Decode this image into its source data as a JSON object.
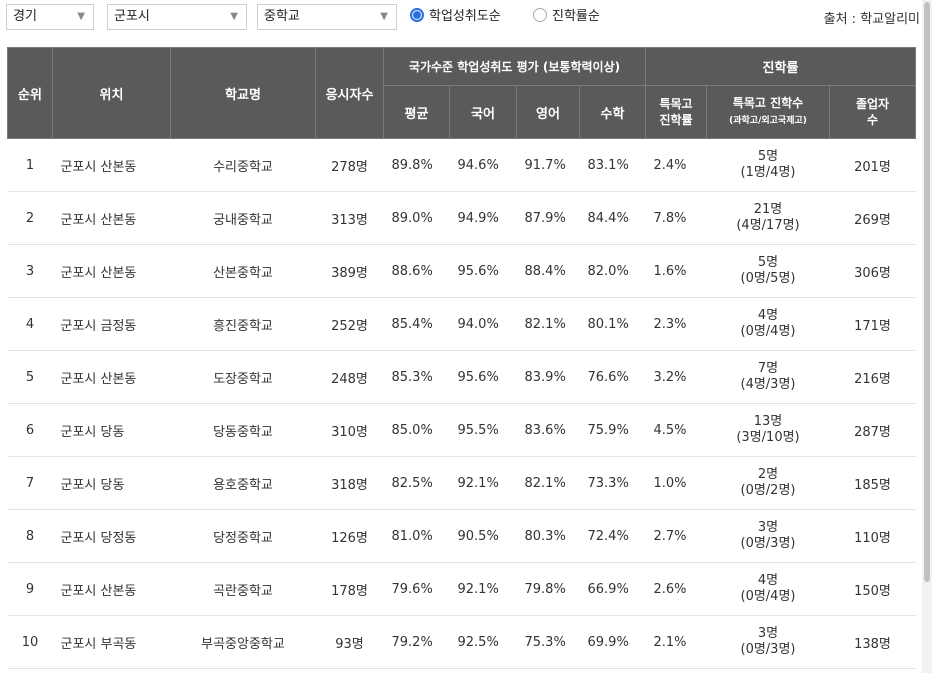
{
  "filters": {
    "province": "경기",
    "city": "군포시",
    "level": "중학교",
    "sort_options": [
      {
        "label": "학업성취도순",
        "selected": true
      },
      {
        "label": "진학률순",
        "selected": false
      }
    ],
    "source": "출처 : 학교알리미"
  },
  "table": {
    "headers": {
      "rank": "순위",
      "location": "위치",
      "school": "학교명",
      "examinees": "응시자수",
      "assessment_group": "국가수준 학업성취도 평가 (보통학력이상)",
      "avg": "평균",
      "korean": "국어",
      "english": "영어",
      "math": "수학",
      "advancement_group": "진학률",
      "special_rate_1": "특목고",
      "special_rate_2": "진학률",
      "special_count_1": "특목고 진학수",
      "special_count_2": "(과학고/외고국제고)",
      "graduates_1": "졸업자",
      "graduates_2": "수"
    },
    "rows": [
      {
        "rank": "1",
        "location": "군포시 산본동",
        "school": "수리중학교",
        "examinees": "278명",
        "avg": "89.8%",
        "korean": "94.6%",
        "english": "91.7%",
        "math": "83.1%",
        "special_rate": "2.4%",
        "special_count": "5명",
        "special_detail": "(1명/4명)",
        "graduates": "201명"
      },
      {
        "rank": "2",
        "location": "군포시 산본동",
        "school": "궁내중학교",
        "examinees": "313명",
        "avg": "89.0%",
        "korean": "94.9%",
        "english": "87.9%",
        "math": "84.4%",
        "special_rate": "7.8%",
        "special_count": "21명",
        "special_detail": "(4명/17명)",
        "graduates": "269명"
      },
      {
        "rank": "3",
        "location": "군포시 산본동",
        "school": "산본중학교",
        "examinees": "389명",
        "avg": "88.6%",
        "korean": "95.6%",
        "english": "88.4%",
        "math": "82.0%",
        "special_rate": "1.6%",
        "special_count": "5명",
        "special_detail": "(0명/5명)",
        "graduates": "306명"
      },
      {
        "rank": "4",
        "location": "군포시 금정동",
        "school": "흥진중학교",
        "examinees": "252명",
        "avg": "85.4%",
        "korean": "94.0%",
        "english": "82.1%",
        "math": "80.1%",
        "special_rate": "2.3%",
        "special_count": "4명",
        "special_detail": "(0명/4명)",
        "graduates": "171명"
      },
      {
        "rank": "5",
        "location": "군포시 산본동",
        "school": "도장중학교",
        "examinees": "248명",
        "avg": "85.3%",
        "korean": "95.6%",
        "english": "83.9%",
        "math": "76.6%",
        "special_rate": "3.2%",
        "special_count": "7명",
        "special_detail": "(4명/3명)",
        "graduates": "216명"
      },
      {
        "rank": "6",
        "location": "군포시 당동",
        "school": "당동중학교",
        "examinees": "310명",
        "avg": "85.0%",
        "korean": "95.5%",
        "english": "83.6%",
        "math": "75.9%",
        "special_rate": "4.5%",
        "special_count": "13명",
        "special_detail": "(3명/10명)",
        "graduates": "287명"
      },
      {
        "rank": "7",
        "location": "군포시 당동",
        "school": "용호중학교",
        "examinees": "318명",
        "avg": "82.5%",
        "korean": "92.1%",
        "english": "82.1%",
        "math": "73.3%",
        "special_rate": "1.0%",
        "special_count": "2명",
        "special_detail": "(0명/2명)",
        "graduates": "185명"
      },
      {
        "rank": "8",
        "location": "군포시 당정동",
        "school": "당정중학교",
        "examinees": "126명",
        "avg": "81.0%",
        "korean": "90.5%",
        "english": "80.3%",
        "math": "72.4%",
        "special_rate": "2.7%",
        "special_count": "3명",
        "special_detail": "(0명/3명)",
        "graduates": "110명"
      },
      {
        "rank": "9",
        "location": "군포시 산본동",
        "school": "곡란중학교",
        "examinees": "178명",
        "avg": "79.6%",
        "korean": "92.1%",
        "english": "79.8%",
        "math": "66.9%",
        "special_rate": "2.6%",
        "special_count": "4명",
        "special_detail": "(0명/4명)",
        "graduates": "150명"
      },
      {
        "rank": "10",
        "location": "군포시 부곡동",
        "school": "부곡중앙중학교",
        "examinees": "93명",
        "avg": "79.2%",
        "korean": "92.5%",
        "english": "75.3%",
        "math": "69.9%",
        "special_rate": "2.1%",
        "special_count": "3명",
        "special_detail": "(0명/3명)",
        "graduates": "138명"
      }
    ]
  },
  "icons": {
    "dropdown": "chevron-down-icon",
    "radio": "radio-icon"
  }
}
